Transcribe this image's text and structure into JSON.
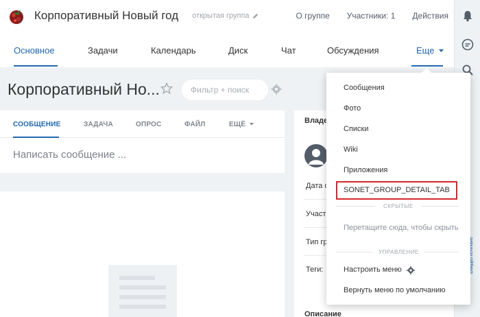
{
  "header": {
    "group_title": "Корпоративный Новый год",
    "group_type": "открытая группа",
    "links": [
      "О группе",
      "Участники: 1",
      "Действия"
    ]
  },
  "nav": {
    "tabs": [
      "Основное",
      "Задачи",
      "Календарь",
      "Диск",
      "Чат",
      "Обсуждения"
    ],
    "more_label": "Еще"
  },
  "page": {
    "title": "Корпоративный Но...",
    "filter_placeholder": "Фильтр + поиск"
  },
  "post": {
    "tabs": [
      "СООБЩЕНИЕ",
      "ЗАДАЧА",
      "ОПРОС",
      "ФАЙЛ",
      "ЕЩЁ"
    ],
    "input_placeholder": "Написать сообщение ..."
  },
  "info": {
    "owner_label": "Владе",
    "rows": [
      "Дата с",
      "Участ",
      "Тип гр",
      "Теги:"
    ],
    "description_label": "Описание"
  },
  "dropdown": {
    "items": [
      "Сообщения",
      "Фото",
      "Списки",
      "Wiki",
      "Приложения"
    ],
    "highlighted_item": "SONET_GROUP_DETAIL_TAB",
    "hidden_section": "СКРЫТЫЕ",
    "drag_hint": "Перетащите сюда, чтобы скрыть",
    "manage_section": "УПРАВЛЕНИЕ",
    "configure_label": "Настроить меню",
    "reset_label": "Вернуть меню по умолчанию"
  },
  "sidebar": {
    "vertical_label": "Выделенные"
  },
  "colors": {
    "accent": "#2067b0",
    "highlight_border": "#d6262b",
    "background": "#eef2f4"
  }
}
